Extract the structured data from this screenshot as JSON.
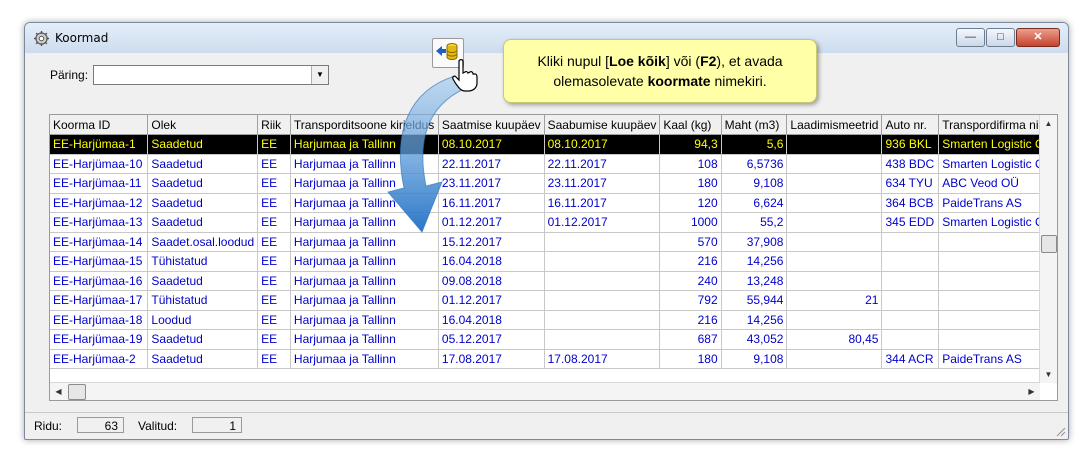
{
  "window": {
    "title": "Koormad"
  },
  "query": {
    "label": "Päring:",
    "value": ""
  },
  "callout": {
    "line1_pre": "Kliki nupul [",
    "line1_bold1": "Loe kõik",
    "line1_mid": "] või (",
    "line1_bold2": "F2",
    "line1_post": "), et avada",
    "line2_pre": "olemasolevate ",
    "line2_bold": "koormate",
    "line2_post": " nimekiri."
  },
  "grid": {
    "columns": [
      "Koorma ID",
      "Olek",
      "Riik",
      "Transporditsoone kirjeldus",
      "Saatmise kuupäev",
      "Saabumise kuupäev",
      "Kaal (kg)",
      "Maht (m3)",
      "Laadimismeetrid",
      "Auto nr.",
      "Transpordifirma nimi"
    ],
    "rows": [
      [
        "EE-Harjümaa-1",
        "Saadetud",
        "EE",
        "Harjumaa ja Tallinn",
        "08.10.2017",
        "08.10.2017",
        "94,3",
        "5,6",
        "",
        "936 BKL",
        "Smarten Logistic OÜ"
      ],
      [
        "EE-Harjümaa-10",
        "Saadetud",
        "EE",
        "Harjumaa ja Tallinn",
        "22.11.2017",
        "22.11.2017",
        "108",
        "6,5736",
        "",
        "438 BDC",
        "Smarten Logistic OÜ"
      ],
      [
        "EE-Harjümaa-11",
        "Saadetud",
        "EE",
        "Harjumaa ja Tallinn",
        "23.11.2017",
        "23.11.2017",
        "180",
        "9,108",
        "",
        "634 TYU",
        "ABC Veod OÜ"
      ],
      [
        "EE-Harjümaa-12",
        "Saadetud",
        "EE",
        "Harjumaa ja Tallinn",
        "16.11.2017",
        "16.11.2017",
        "120",
        "6,624",
        "",
        "364 BCB",
        "PaideTrans AS"
      ],
      [
        "EE-Harjümaa-13",
        "Saadetud",
        "EE",
        "Harjumaa ja Tallinn",
        "01.12.2017",
        "01.12.2017",
        "1000",
        "55,2",
        "",
        "345 EDD",
        "Smarten Logistic OÜ"
      ],
      [
        "EE-Harjümaa-14",
        "Saadet.osal.loodud",
        "EE",
        "Harjumaa ja Tallinn",
        "15.12.2017",
        "",
        "570",
        "37,908",
        "",
        "",
        ""
      ],
      [
        "EE-Harjümaa-15",
        "Tühistatud",
        "EE",
        "Harjumaa ja Tallinn",
        "16.04.2018",
        "",
        "216",
        "14,256",
        "",
        "",
        ""
      ],
      [
        "EE-Harjümaa-16",
        "Saadetud",
        "EE",
        "Harjumaa ja Tallinn",
        "09.08.2018",
        "",
        "240",
        "13,248",
        "",
        "",
        ""
      ],
      [
        "EE-Harjümaa-17",
        "Tühistatud",
        "EE",
        "Harjumaa ja Tallinn",
        "01.12.2017",
        "",
        "792",
        "55,944",
        "21",
        "",
        ""
      ],
      [
        "EE-Harjümaa-18",
        "Loodud",
        "EE",
        "Harjumaa ja Tallinn",
        "16.04.2018",
        "",
        "216",
        "14,256",
        "",
        "",
        ""
      ],
      [
        "EE-Harjümaa-19",
        "Saadetud",
        "EE",
        "Harjumaa ja Tallinn",
        "05.12.2017",
        "",
        "687",
        "43,052",
        "80,45",
        "",
        ""
      ],
      [
        "EE-Harjümaa-2",
        "Saadetud",
        "EE",
        "Harjumaa ja Tallinn",
        "17.08.2017",
        "17.08.2017",
        "180",
        "9,108",
        "",
        "344 ACR",
        "PaideTrans AS"
      ]
    ],
    "selected_row": 0
  },
  "status": {
    "rows_label": "Ridu:",
    "rows_value": "63",
    "selected_label": "Valitud:",
    "selected_value": "1"
  },
  "colors": {
    "row_text": "#0000cc",
    "selected_bg": "#000000",
    "selected_text": "#ffff00",
    "callout_bg": "#ffffa8",
    "arrow": "#3a8fd8"
  },
  "icons": {
    "window": "gear-icon",
    "load_all": "database-load-icon",
    "pointer": "hand-pointer-icon"
  }
}
